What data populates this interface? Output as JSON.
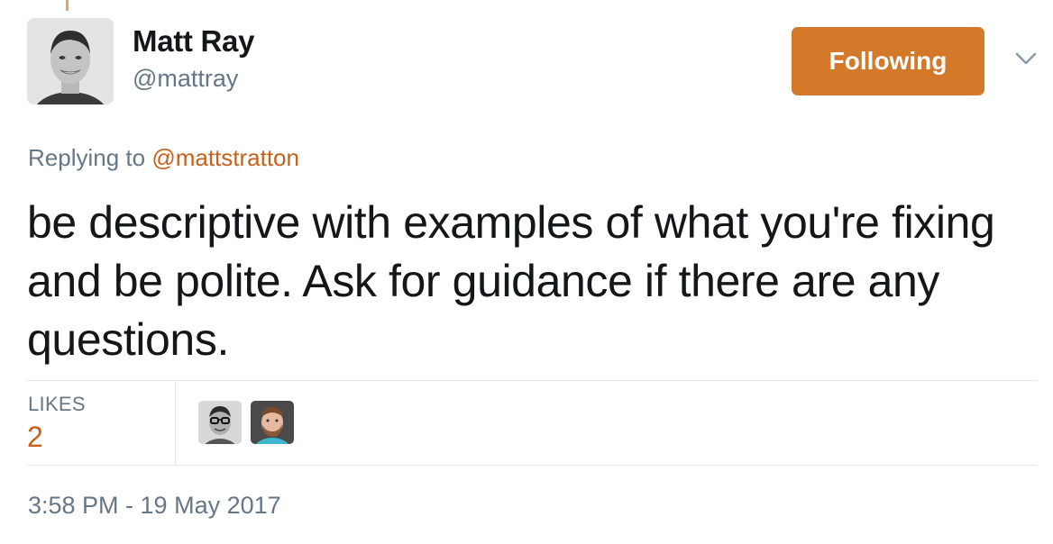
{
  "tweet": {
    "author": {
      "name": "Matt Ray",
      "handle": "@mattray",
      "avatar_icon": "profile-photo"
    },
    "follow_button": {
      "label": "Following",
      "color": "#d4782a"
    },
    "menu_icon": "chevron-down-icon",
    "reply": {
      "prefix": "Replying to",
      "target": "@mattstratton"
    },
    "text": "be descriptive with examples of what you're fixing and be polite. Ask for guidance if there are any questions.",
    "stats": {
      "likes_label": "LIKES",
      "likes_count": "2",
      "likers": [
        "liker-avatar-glasses",
        "liker-avatar-beard"
      ]
    },
    "timestamp": "3:58 PM - 19 May 2017"
  },
  "colors": {
    "accent": "#c6611b",
    "muted_text": "#657786",
    "primary_text": "#14171a",
    "divider": "#e1e8ed"
  }
}
